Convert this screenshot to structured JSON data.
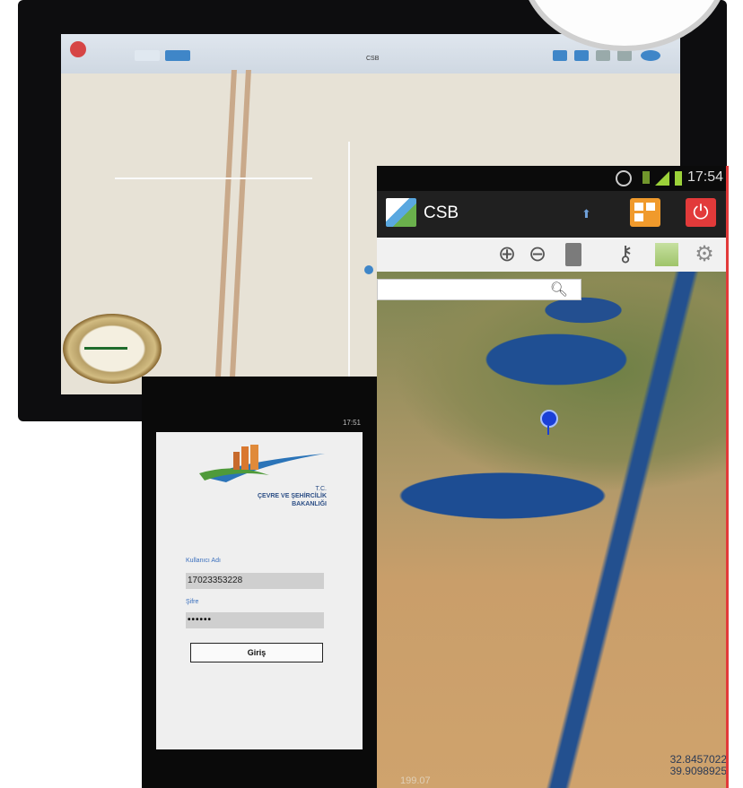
{
  "tablet": {
    "title": "CSB"
  },
  "android": {
    "status_time": "17:54",
    "app_title": "CSB",
    "map": {
      "coordinates_line1": "32.8457022",
      "coordinates_line2": "39.9098925",
      "scale_text": "199.07"
    }
  },
  "login": {
    "time": "17:51",
    "ministry_tc": "T.C.",
    "ministry_line1": "ÇEVRE VE ŞEHİRCİLİK",
    "ministry_line2": "BAKANLIĞI",
    "username_label": "Kullanıcı Adı",
    "username_value": "17023353228",
    "password_label": "Şifre",
    "password_value": "••••••",
    "login_button": "Giriş"
  }
}
